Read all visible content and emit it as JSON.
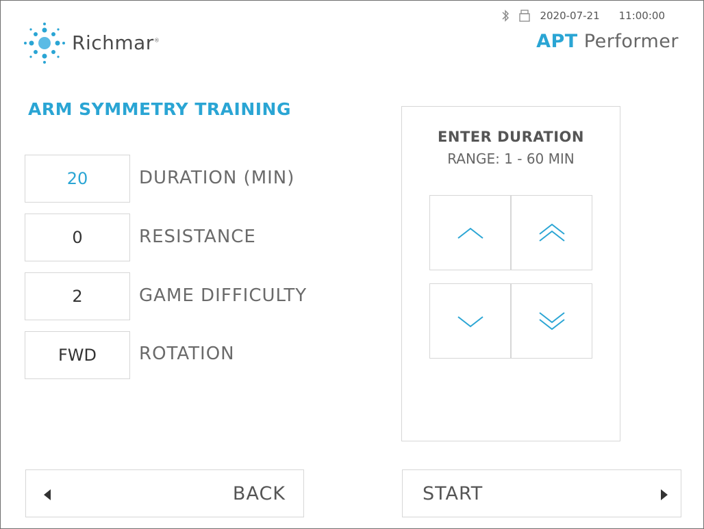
{
  "header": {
    "brand_name": "Richmar",
    "brand_mark": "®",
    "status": {
      "bluetooth_icon": "bluetooth-icon",
      "storage_icon": "usb-drive-icon",
      "date": "2020-07-21",
      "time": "11:00:00"
    },
    "product_brand": "APT",
    "product_name": "Performer"
  },
  "page": {
    "title": "ARM SYMMETRY TRAINING"
  },
  "params": [
    {
      "value": "20",
      "label": "DURATION (MIN)",
      "active": true
    },
    {
      "value": "0",
      "label": "RESISTANCE",
      "active": false
    },
    {
      "value": "2",
      "label": "GAME DIFFICULTY",
      "active": false
    },
    {
      "value": "FWD",
      "label": "ROTATION",
      "active": false
    }
  ],
  "panel": {
    "heading": "ENTER DURATION",
    "range": "RANGE: 1 - 60 MIN",
    "buttons": [
      {
        "icon": "chevron-up-icon"
      },
      {
        "icon": "double-chevron-up-icon"
      },
      {
        "icon": "chevron-down-icon"
      },
      {
        "icon": "double-chevron-down-icon"
      }
    ]
  },
  "footer": {
    "back_label": "BACK",
    "back_icon": "triangle-left-icon",
    "start_label": "START",
    "start_icon": "triangle-right-icon"
  },
  "colors": {
    "accent": "#2aa5d4",
    "text": "#555555",
    "border": "#d6d6d6"
  }
}
